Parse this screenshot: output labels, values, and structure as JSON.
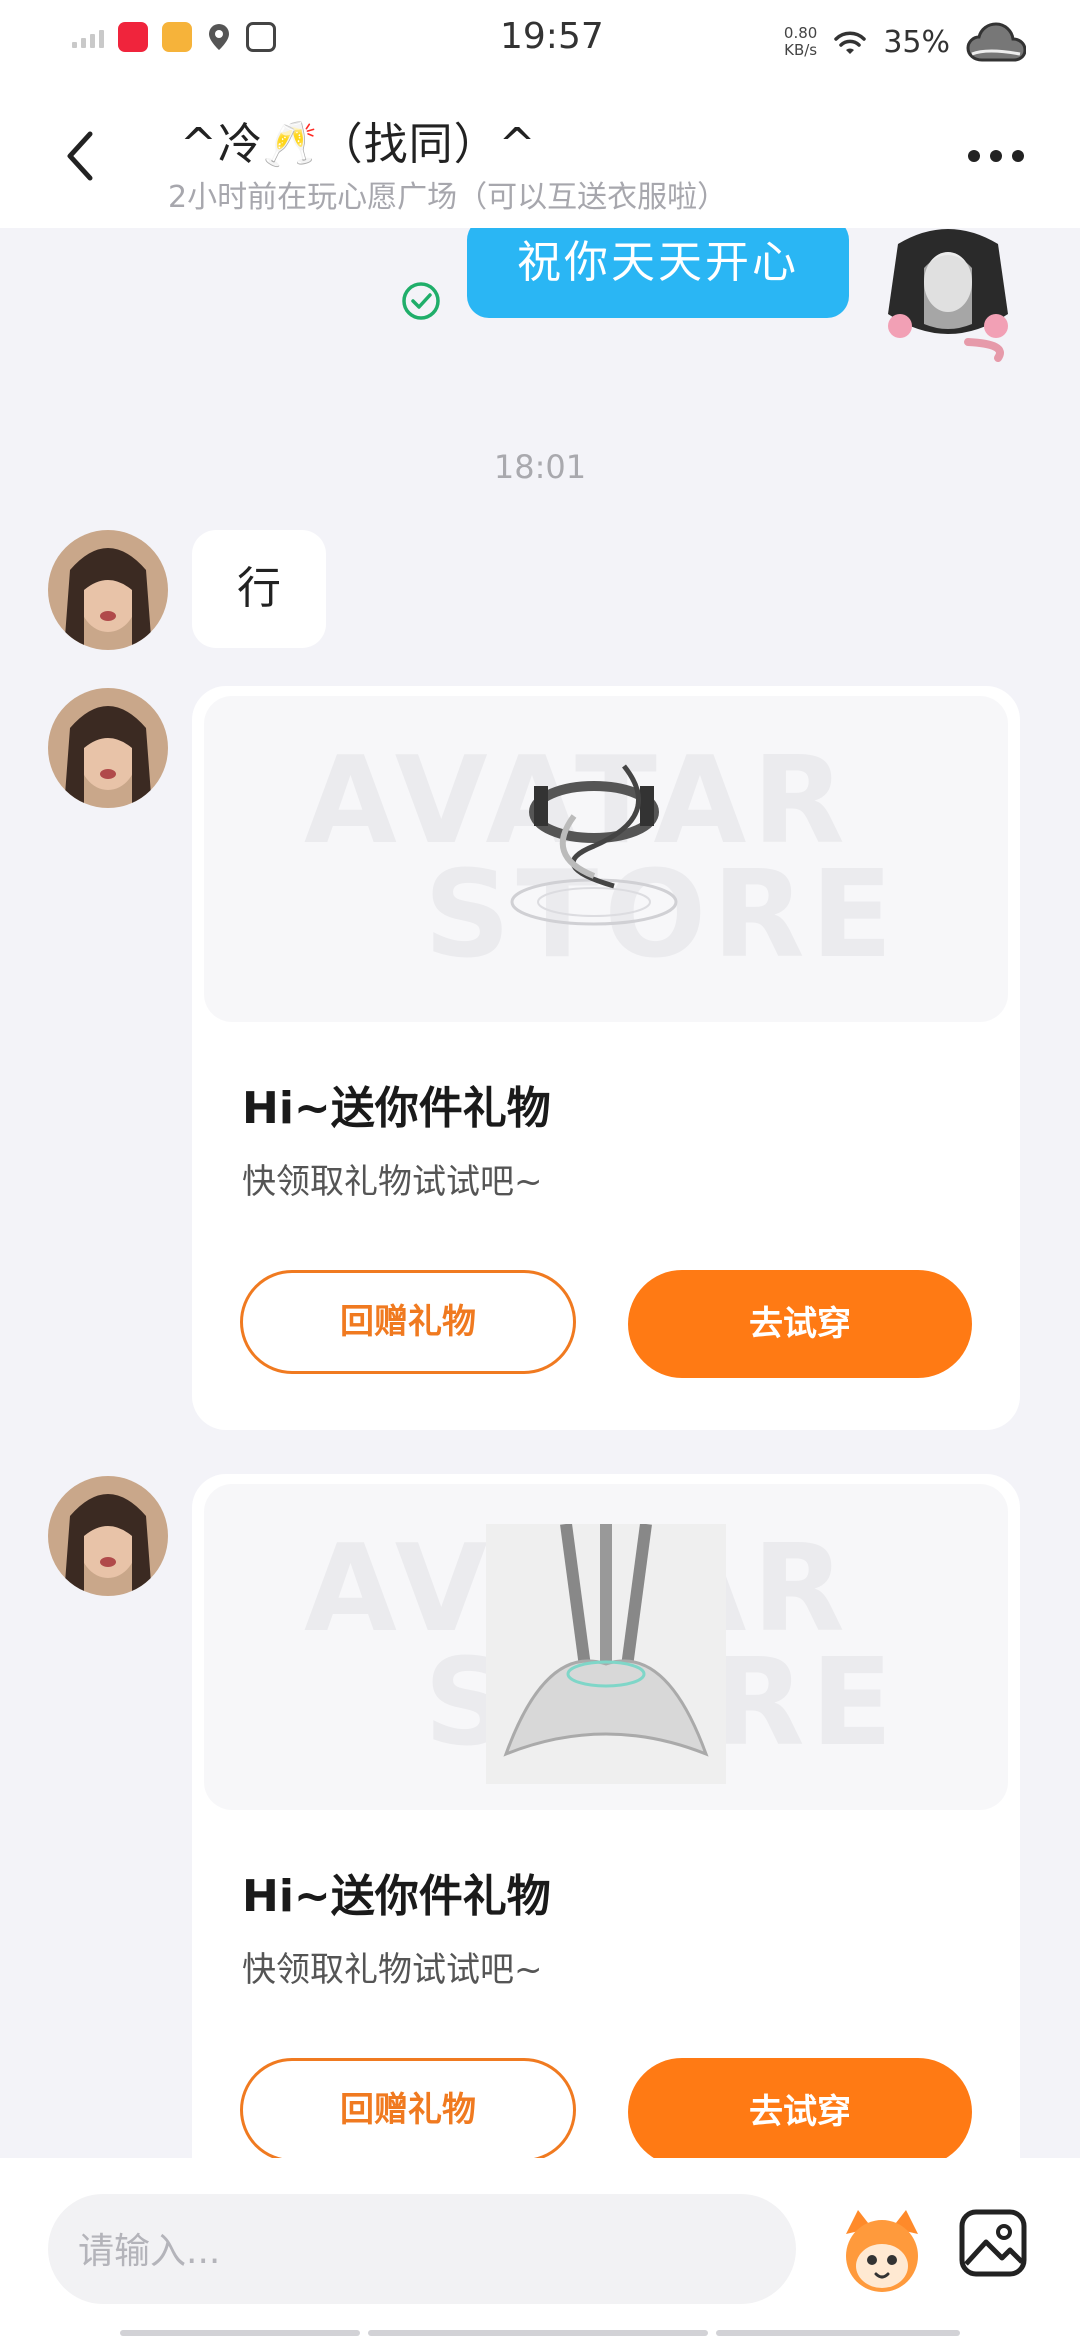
{
  "status_bar": {
    "time": "19:57",
    "net_speed_value": "0.80",
    "net_speed_unit": "KB/s",
    "battery": "35%",
    "app_icons": [
      "xiaohongshu-icon",
      "video-app-icon",
      "location-icon",
      "du-app-icon"
    ]
  },
  "header": {
    "title": "^冷🥂（找同）^",
    "subtitle": "2小时前在玩心愿广场（可以互送衣服啦）"
  },
  "messages": {
    "outgoing_text": "祝你天天开心",
    "time_divider": "18:01",
    "incoming_text": "行"
  },
  "gift_cards": [
    {
      "title": "Hi~送你件礼物",
      "subtitle": "快领取礼物试试吧~",
      "return_label": "回赠礼物",
      "tryon_label": "去试穿",
      "watermark_top": "AVATAR",
      "watermark_bottom": "STORE"
    },
    {
      "title": "Hi~送你件礼物",
      "subtitle": "快领取礼物试试吧~",
      "return_label": "回赠礼物",
      "tryon_label": "去试穿",
      "watermark_top": "AVATAR",
      "watermark_bottom": "STORE"
    }
  ],
  "input": {
    "placeholder": "请输入..."
  },
  "colors": {
    "outgoing_bubble": "#2ab6f4",
    "accent_orange": "#ff7a14",
    "background": "#f3f3f8"
  }
}
